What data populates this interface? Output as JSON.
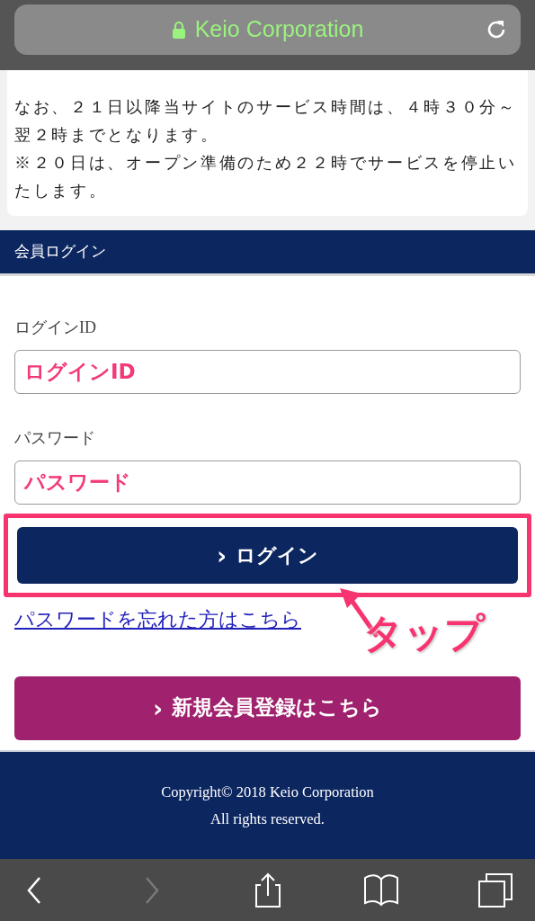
{
  "address_bar": {
    "title": "Keio Corporation",
    "secure": true
  },
  "notice": {
    "paragraphs": [
      "なお、２１日以降当サイトのサービス時間は、４時３０分～翌２時までとなります。",
      "※２０日は、オープン準備のため２２時でサービスを停止いたします。"
    ]
  },
  "login": {
    "heading": "会員ログイン",
    "fields": [
      {
        "label": "ログインID",
        "annotation": "ログインID"
      },
      {
        "label": "パスワード",
        "annotation": "パスワード"
      }
    ],
    "login_button": {
      "icon": "›",
      "label": "ログイン",
      "highlighted": true
    },
    "forgot_link": "パスワードを忘れた方はこちら",
    "callout": "タップ",
    "register_button": {
      "icon": "›",
      "label": "新規会員登録はこちら"
    }
  },
  "footer": [
    "Copyright© 2018 Keio Corporation",
    "All rights reserved."
  ],
  "toolbar": [
    {
      "kind": "back",
      "disabled": false
    },
    {
      "kind": "forward",
      "disabled": true
    },
    {
      "kind": "share",
      "disabled": false
    },
    {
      "kind": "bookmarks",
      "disabled": false
    },
    {
      "kind": "tabs",
      "disabled": false
    }
  ]
}
